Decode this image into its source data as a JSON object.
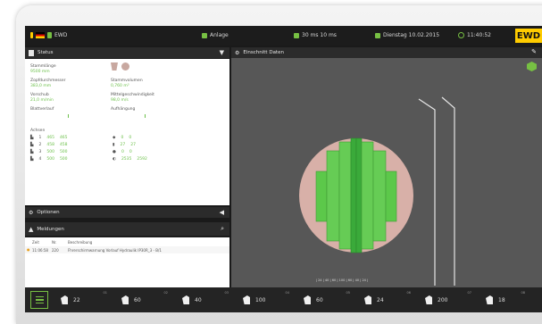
{
  "topbar": {
    "user": "EWD",
    "mode": "Anlage",
    "cycle": "30 ms 10 ms",
    "date": "Dienstag 10.02.2015",
    "time": "11:40:52",
    "logo": "EWD",
    "accent": "#77c043",
    "logo_color": "#ffcc00"
  },
  "status_panel": {
    "title": "Status",
    "fields": [
      {
        "label": "Stammlänge",
        "value": "9500 mm"
      },
      {
        "label": "Stammvolumen",
        "value": "0,760 m³"
      },
      {
        "label": "Zopfdurchmesser",
        "value": "383,0 mm"
      },
      {
        "label": "Mittelgeschwindigkeit",
        "value": "98,0 m/s"
      },
      {
        "label": "Vorschub",
        "value": "21,0 m/min"
      },
      {
        "label": "Aufhängung",
        "value": ""
      },
      {
        "label": "Blattverlauf",
        "value": ""
      }
    ],
    "axes_title": "Achsen",
    "axes": [
      {
        "id": "1",
        "a": "465",
        "b": "465"
      },
      {
        "id": "2",
        "a": "458",
        "b": "458"
      },
      {
        "id": "3",
        "a": "500",
        "b": "500"
      },
      {
        "id": "4",
        "a": "500",
        "b": "500"
      }
    ],
    "axes_right": [
      {
        "a": "0",
        "b": "0"
      },
      {
        "a": "27",
        "b": "27"
      },
      {
        "a": "0",
        "b": "0"
      },
      {
        "a": "2535",
        "b": "2592"
      }
    ]
  },
  "view_panel": {
    "title": "Einschnitt Daten"
  },
  "options": {
    "title": "Optionen"
  },
  "messages": {
    "title": "Meldungen",
    "columns": [
      "Zeit",
      "Nr.",
      "Beschreibung"
    ],
    "rows": [
      {
        "time": "11:06:58",
        "nr": "220",
        "desc": "Fhrerschirmwarnung Vorlauf Hydraulik IP30R_3 - B/1"
      }
    ]
  },
  "bottombar": {
    "tools": [
      {
        "value": "22",
        "sup": "01"
      },
      {
        "value": "60",
        "sup": "02"
      },
      {
        "value": "40",
        "sup": "03"
      },
      {
        "value": "100",
        "sup": "04"
      },
      {
        "value": "60",
        "sup": "05"
      },
      {
        "value": "24",
        "sup": "06"
      },
      {
        "value": "200",
        "sup": "07"
      },
      {
        "value": "18",
        "sup": "08"
      }
    ]
  }
}
